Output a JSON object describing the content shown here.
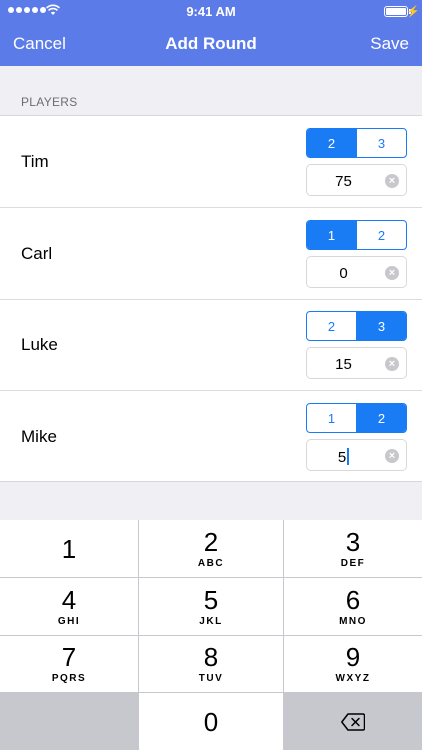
{
  "status": {
    "time": "9:41 AM"
  },
  "nav": {
    "left": "Cancel",
    "title": "Add Round",
    "right": "Save"
  },
  "section": {
    "header": "PLAYERS"
  },
  "players": [
    {
      "name": "Tim",
      "options": [
        "2",
        "3"
      ],
      "selected": 0,
      "value": "75"
    },
    {
      "name": "Carl",
      "options": [
        "1",
        "2"
      ],
      "selected": 0,
      "value": "0"
    },
    {
      "name": "Luke",
      "options": [
        "2",
        "3"
      ],
      "selected": 1,
      "value": "15"
    },
    {
      "name": "Mike",
      "options": [
        "1",
        "2"
      ],
      "selected": 1,
      "value": "5"
    }
  ],
  "keys": [
    {
      "num": "1",
      "letters": ""
    },
    {
      "num": "2",
      "letters": "ABC"
    },
    {
      "num": "3",
      "letters": "DEF"
    },
    {
      "num": "4",
      "letters": "GHI"
    },
    {
      "num": "5",
      "letters": "JKL"
    },
    {
      "num": "6",
      "letters": "MNO"
    },
    {
      "num": "7",
      "letters": "PQRS"
    },
    {
      "num": "8",
      "letters": "TUV"
    },
    {
      "num": "9",
      "letters": "WXYZ"
    },
    {
      "num": "0",
      "letters": ""
    }
  ],
  "colors": {
    "navbar": "#5b7be8",
    "accent": "#1a7cf5"
  },
  "icons": {
    "delete": "delete-backspace-icon",
    "clear": "clear-circle-icon"
  }
}
